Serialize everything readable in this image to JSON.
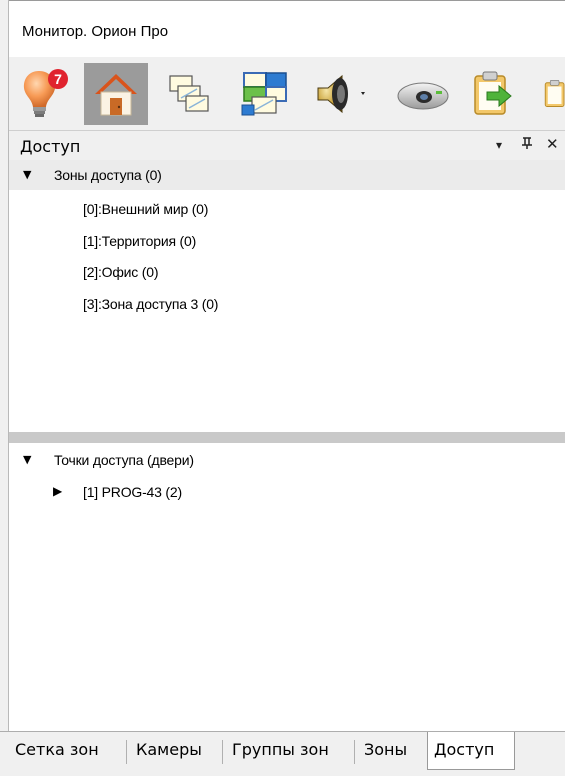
{
  "window": {
    "title": "Монитор. Орион Про"
  },
  "toolbar": {
    "buttons": [
      {
        "icon": "lightbulb-alarm-icon",
        "badge": "7"
      },
      {
        "icon": "home-icon",
        "active": true
      },
      {
        "icon": "plans-icon"
      },
      {
        "icon": "plans-grid-icon"
      },
      {
        "icon": "speaker-icon"
      },
      {
        "icon": "camera-projector-icon"
      },
      {
        "icon": "clipboard-arrow-icon"
      },
      {
        "icon": "clipboard-info-icon"
      }
    ]
  },
  "panel": {
    "title": "Доступ",
    "controls": {
      "menu": "▾",
      "pin": "ᵽ",
      "close": "✕"
    }
  },
  "access_zones": {
    "header": "Зоны доступа (0)",
    "items": [
      "[0]:Внешний мир (0)",
      "[1]:Территория (0)",
      "[2]:Офис (0)",
      "[3]:Зона доступа 3 (0)"
    ]
  },
  "access_points": {
    "header": "Точки доступа (двери)",
    "items": [
      "[1] PROG-43 (2)"
    ]
  },
  "tabs": [
    "Сетка зон",
    "Камеры",
    "Группы зон",
    "Зоны",
    "Доступ"
  ],
  "active_tab": "Доступ",
  "colors": {
    "badge": "#e0232e",
    "active_toolbar": "#9b9b9b",
    "panel_bg": "#f0f0f0"
  }
}
